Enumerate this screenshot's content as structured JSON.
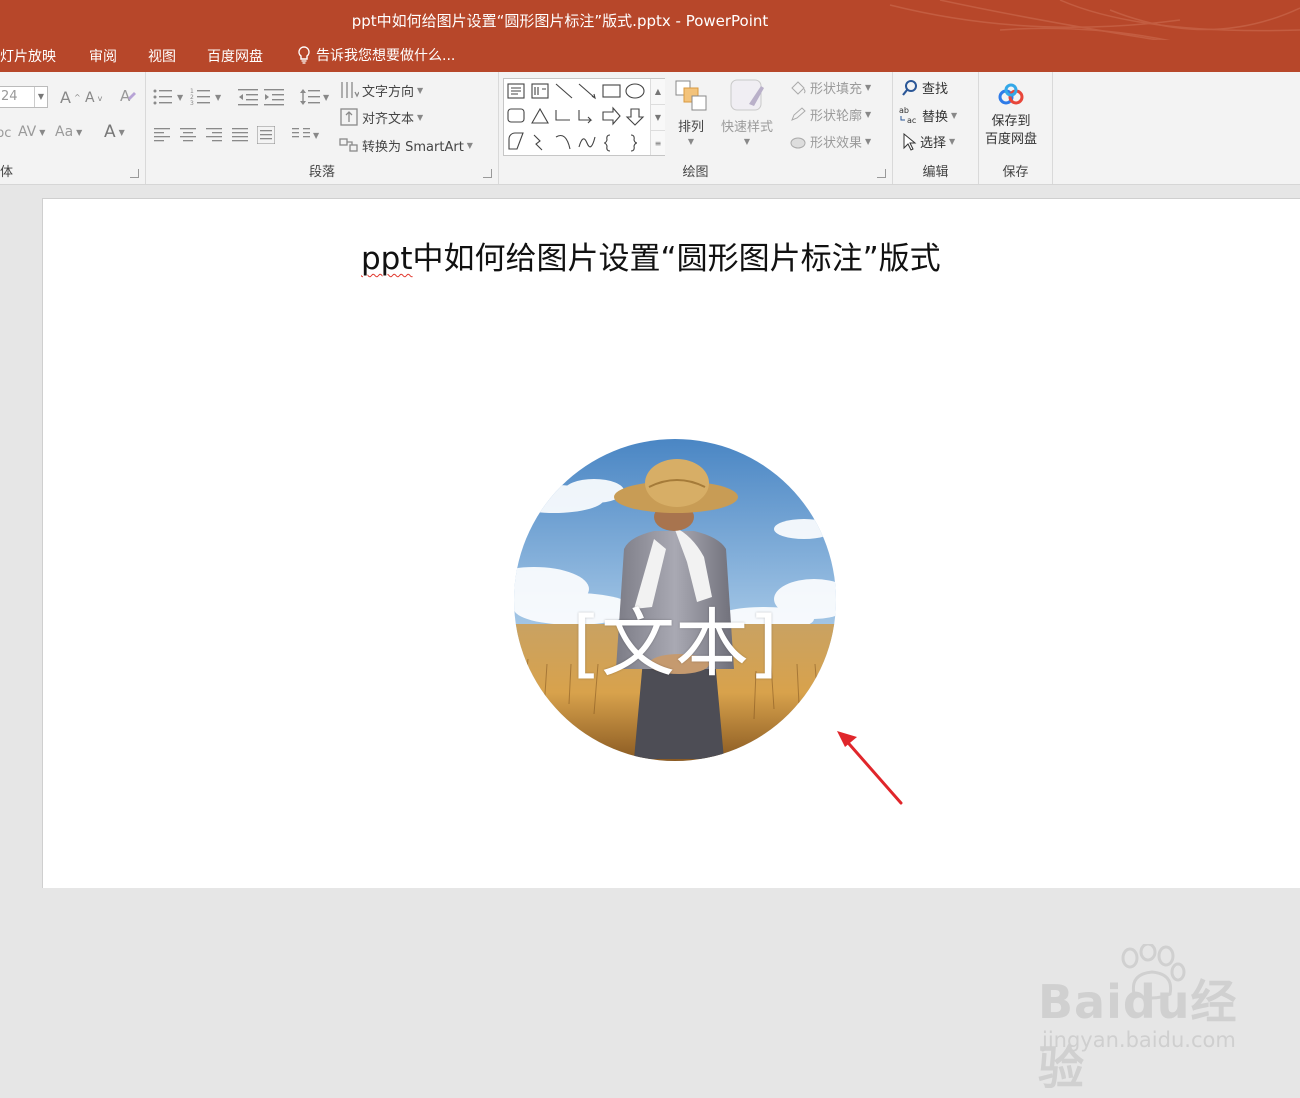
{
  "window": {
    "title": "ppt中如何给图片设置“圆形图片标注”版式.pptx - PowerPoint"
  },
  "tabs": [
    {
      "label": "灯片放映"
    },
    {
      "label": "审阅"
    },
    {
      "label": "视图"
    },
    {
      "label": "百度网盘"
    }
  ],
  "tell_me": {
    "label": "告诉我您想要做什么..."
  },
  "ribbon": {
    "font_group": {
      "label": "体",
      "size_value": "24",
      "grow": "A",
      "shrink": "A",
      "spacing": "AV",
      "case": "Aa",
      "color": "A"
    },
    "paragraph_group": {
      "label": "段落",
      "text_direction": "文字方向",
      "align_text": "对齐文本",
      "convert_smartart": "转换为 SmartArt"
    },
    "drawing_group": {
      "label": "绘图",
      "arrange": "排列",
      "quick_styles": "快速样式",
      "shape_fill": "形状填充",
      "shape_outline": "形状轮廓",
      "shape_effects": "形状效果"
    },
    "editing_group": {
      "label": "编辑",
      "find": "查找",
      "replace": "替换",
      "select": "选择"
    },
    "save_group": {
      "label": "保存",
      "save_line1": "保存到",
      "save_line2": "百度网盘"
    }
  },
  "slide": {
    "title_squiggle": "ppt",
    "title_rest": "中如何给图片设置“圆形图片标注”版式",
    "placeholder_text": "[文本]"
  },
  "watermark": {
    "text": "Baidu经验",
    "url": "jingyan.baidu.com"
  },
  "colors": {
    "accent": "#b7472a",
    "ribbon_bg": "#f3f3f3",
    "annotation_arrow": "#e0262b"
  }
}
